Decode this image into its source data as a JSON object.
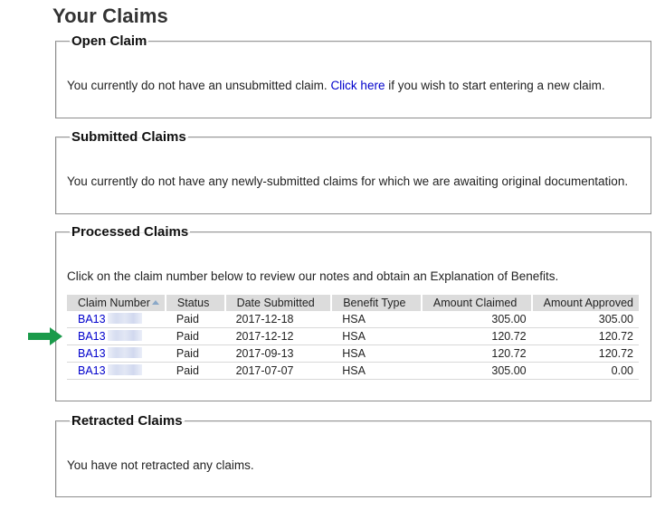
{
  "page": {
    "title": "Your Claims"
  },
  "open_claim": {
    "legend": "Open Claim",
    "text_before": "You currently do not have an unsubmitted claim. ",
    "link_text": "Click here",
    "text_after": " if you wish to start entering a new claim."
  },
  "submitted_claims": {
    "legend": "Submitted Claims",
    "text": "You currently do not have any newly-submitted claims for which we are awaiting original documentation."
  },
  "processed_claims": {
    "legend": "Processed Claims",
    "text": "Click on the claim number below to review our notes and obtain an Explanation of Benefits.",
    "columns": [
      "Claim Number",
      "Status",
      "Date Submitted",
      "Benefit Type",
      "Amount Claimed",
      "Amount Approved"
    ],
    "rows": [
      {
        "claim": "BA13",
        "status": "Paid",
        "date": "2017-12-18",
        "type": "HSA",
        "claimed": "305.00",
        "approved": "305.00"
      },
      {
        "claim": "BA13",
        "status": "Paid",
        "date": "2017-12-12",
        "type": "HSA",
        "claimed": "120.72",
        "approved": "120.72"
      },
      {
        "claim": "BA13",
        "status": "Paid",
        "date": "2017-09-13",
        "type": "HSA",
        "claimed": "120.72",
        "approved": "120.72"
      },
      {
        "claim": "BA13",
        "status": "Paid",
        "date": "2017-07-07",
        "type": "HSA",
        "claimed": "305.00",
        "approved": "0.00"
      }
    ]
  },
  "retracted_claims": {
    "legend": "Retracted Claims",
    "text": "You have not retracted any claims."
  },
  "annotations": {
    "arrow_icon": "green-right-arrow-icon",
    "arrow_color": "#1a9a4a",
    "link_color": "#0000cc"
  }
}
